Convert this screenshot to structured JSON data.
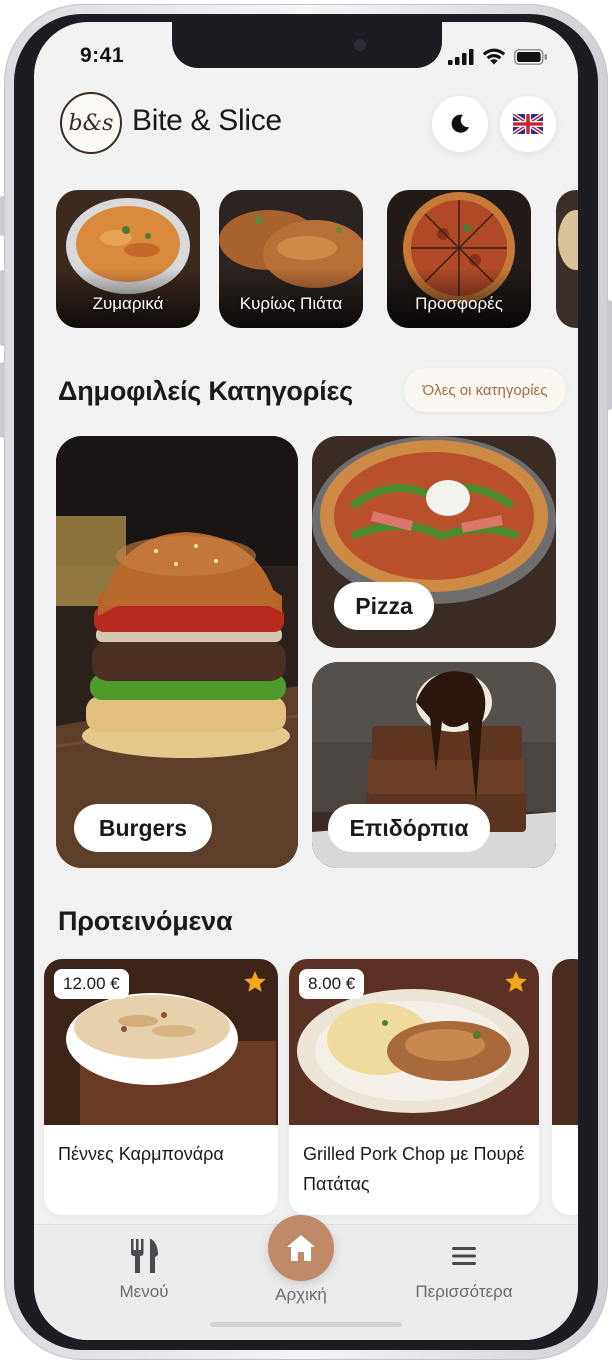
{
  "status_bar": {
    "time": "9:41"
  },
  "header": {
    "logo_text": "b&s",
    "brand_name": "Bite & Slice",
    "theme_icon": "moon-icon",
    "language_icon": "uk-flag-icon"
  },
  "top_categories": [
    {
      "label": "Ζυμαρικά"
    },
    {
      "label": "Κυρίως Πιάτα"
    },
    {
      "label": "Προσφορές"
    }
  ],
  "popular": {
    "title": "Δημοφιλείς Κατηγορίες",
    "all_link": "Όλες οι κατηγορίες",
    "items": [
      {
        "label": "Burgers"
      },
      {
        "label": "Pizza"
      },
      {
        "label": "Επιδόρπια"
      }
    ]
  },
  "recommended": {
    "title": "Προτεινόμενα",
    "items": [
      {
        "price": "12.00 €",
        "name": "Πέννες Καρμπονάρα"
      },
      {
        "price": "8.00 €",
        "name": "Grilled Pork Chop με Πουρέ Πατάτας"
      }
    ]
  },
  "tabbar": {
    "menu_label": "Μενού",
    "home_label": "Αρχική",
    "more_label": "Περισσότερα"
  },
  "colors": {
    "accent": "#c08a68",
    "link_text": "#a56a45",
    "star": "#f2a71b",
    "background": "#f2f2f3"
  }
}
